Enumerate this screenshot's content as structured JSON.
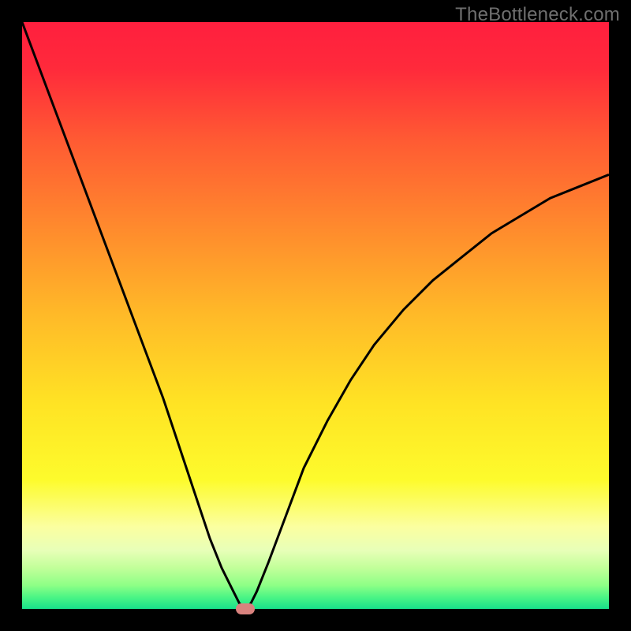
{
  "watermark": "TheBottleneck.com",
  "chart_data": {
    "type": "line",
    "title": "",
    "xlabel": "",
    "ylabel": "",
    "xlim": [
      0,
      100
    ],
    "ylim": [
      0,
      100
    ],
    "gradient_stops": [
      {
        "pos": 0,
        "color": "#ff1f3e"
      },
      {
        "pos": 8,
        "color": "#ff2a3b"
      },
      {
        "pos": 20,
        "color": "#ff5a33"
      },
      {
        "pos": 35,
        "color": "#ff8a2d"
      },
      {
        "pos": 50,
        "color": "#ffba28"
      },
      {
        "pos": 65,
        "color": "#ffe324"
      },
      {
        "pos": 78,
        "color": "#fdfb2c"
      },
      {
        "pos": 86,
        "color": "#fbffa0"
      },
      {
        "pos": 90,
        "color": "#e8ffb8"
      },
      {
        "pos": 93,
        "color": "#c2ff9a"
      },
      {
        "pos": 96,
        "color": "#8dff86"
      },
      {
        "pos": 98,
        "color": "#4bf585"
      },
      {
        "pos": 100,
        "color": "#18e08a"
      }
    ],
    "series": [
      {
        "name": "bottleneck-curve",
        "color": "#000000",
        "x": [
          0,
          3,
          6,
          9,
          12,
          15,
          18,
          21,
          24,
          27,
          30,
          32,
          34,
          36,
          37,
          38,
          39,
          40,
          42,
          45,
          48,
          52,
          56,
          60,
          65,
          70,
          75,
          80,
          85,
          90,
          95,
          100
        ],
        "y": [
          100,
          92,
          84,
          76,
          68,
          60,
          52,
          44,
          36,
          27,
          18,
          12,
          7,
          3,
          1,
          0,
          1,
          3,
          8,
          16,
          24,
          32,
          39,
          45,
          51,
          56,
          60,
          64,
          67,
          70,
          72,
          74
        ]
      }
    ],
    "marker": {
      "x": 38,
      "y": 0,
      "w": 3.2,
      "h": 1.8,
      "color": "#d9827e"
    }
  }
}
